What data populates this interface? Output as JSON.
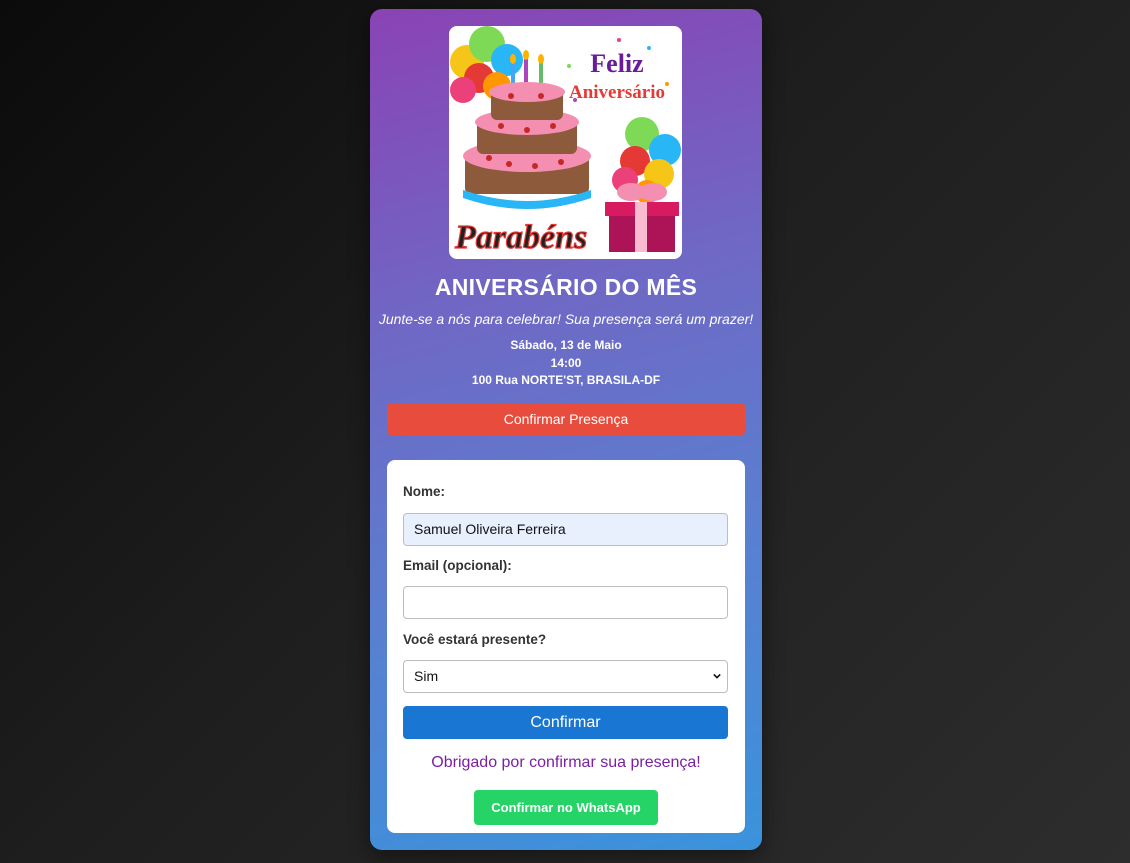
{
  "invitation": {
    "image_text": {
      "top": "Feliz",
      "middle": "Aniversário",
      "bottom": "Parabéns"
    },
    "title": "ANIVERSÁRIO DO MÊS",
    "subtitle": "Junte-se a nós para celebrar! Sua presença será um prazer!",
    "date": "Sábado, 13 de Maio",
    "time": "14:00",
    "address": "100 Rua NORTE'ST, BRASILA-DF",
    "confirm_presence_label": "Confirmar Presença"
  },
  "form": {
    "name_label": "Nome:",
    "name_value": "Samuel Oliveira Ferreira",
    "email_label": "Email (opcional):",
    "email_value": "",
    "attend_label": "Você estará presente?",
    "attend_selected": "Sim",
    "submit_label": "Confirmar",
    "thanks_message": "Obrigado por confirmar sua presença!",
    "whatsapp_label": "Confirmar no WhatsApp"
  },
  "colors": {
    "card_gradient_top": "#8a43b4",
    "card_gradient_bottom": "#3a93dc",
    "confirm_presence": "#e74c3c",
    "submit": "#1976d2",
    "thanks_text": "#7b1fa2",
    "whatsapp": "#25d366"
  },
  "icons": [
    "birthday-cake-icon",
    "balloons-icon",
    "gift-box-icon",
    "chevron-down-icon"
  ]
}
